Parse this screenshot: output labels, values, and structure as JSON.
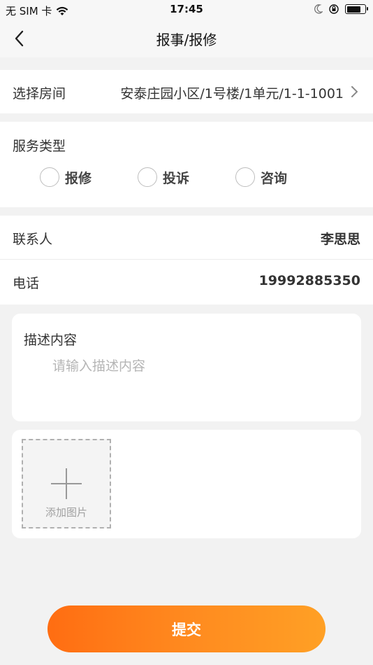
{
  "status_bar": {
    "carrier": "无 SIM 卡",
    "time": "17:45",
    "icons": [
      "wifi-icon",
      "moon-icon",
      "orientation-lock-icon",
      "battery-icon"
    ],
    "battery_level": 0.8
  },
  "nav": {
    "back_icon": "chevron-left-icon",
    "title": "报事/报修"
  },
  "room": {
    "label": "选择房间",
    "value": "安泰庄园小区/1号楼/1单元/1-1-1001",
    "icon": "chevron-right-icon"
  },
  "service": {
    "label": "服务类型",
    "options": [
      {
        "label": "报修",
        "selected": false
      },
      {
        "label": "投诉",
        "selected": false
      },
      {
        "label": "咨询",
        "selected": false
      }
    ]
  },
  "contact": {
    "label": "联系人",
    "value": "李思思"
  },
  "phone": {
    "label": "电话",
    "value": "19992885350"
  },
  "description": {
    "label": "描述内容",
    "placeholder": "请输入描述内容",
    "value": ""
  },
  "photo": {
    "add_label": "添加图片",
    "icon": "plus-icon"
  },
  "submit": {
    "label": "提交"
  },
  "colors": {
    "accent_start": "#ff6d12",
    "accent_end": "#ffa025",
    "background": "#f2f2f2",
    "card": "#ffffff"
  }
}
